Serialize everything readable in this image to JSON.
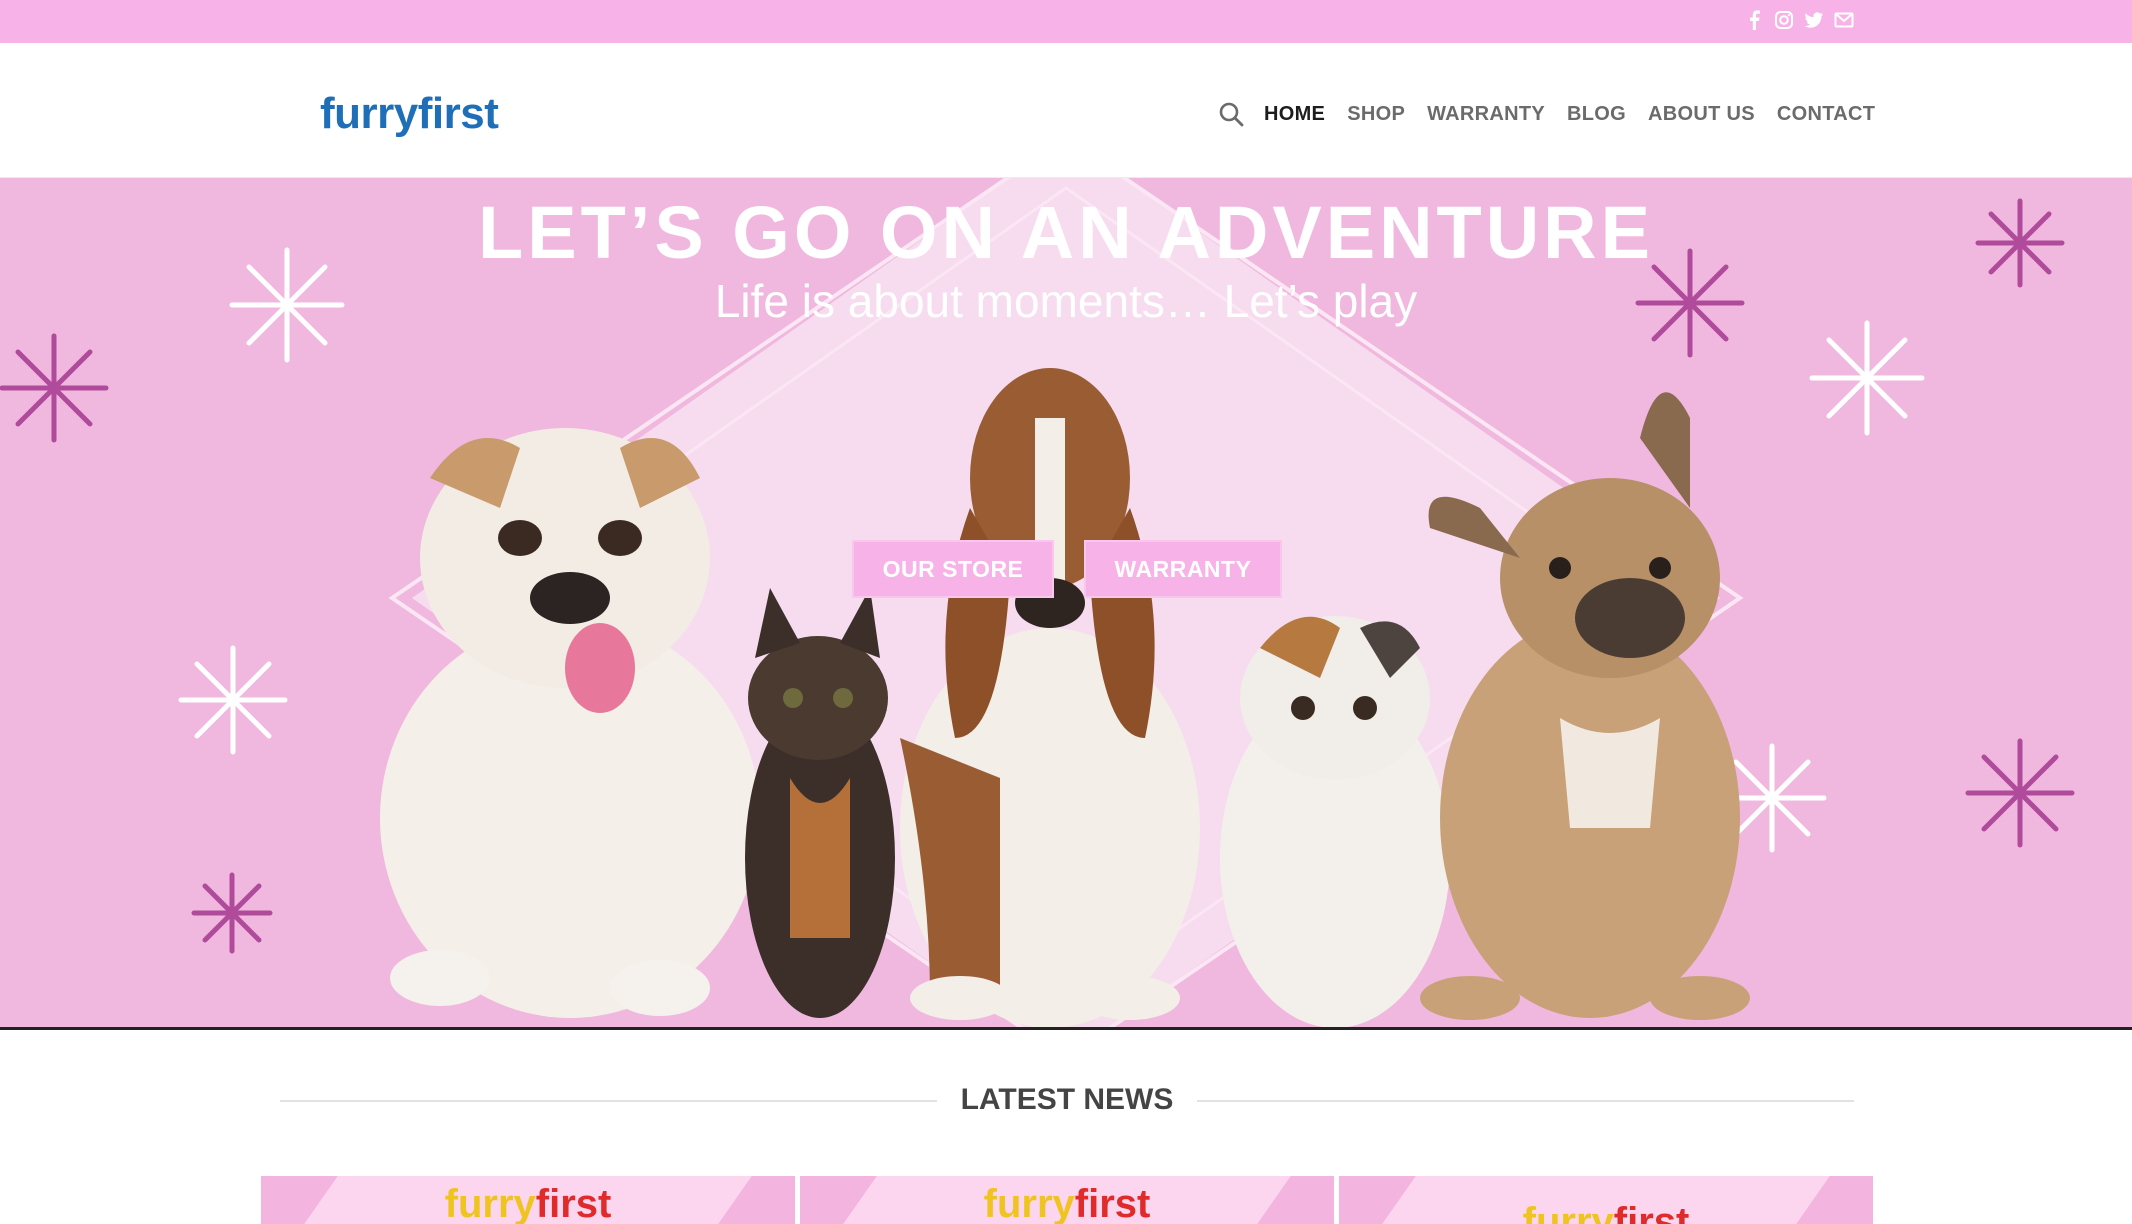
{
  "topbar": {
    "color": "#f7b3e8",
    "social_icons": [
      "facebook-icon",
      "instagram-icon",
      "twitter-icon",
      "email-icon"
    ]
  },
  "header": {
    "logo": "furryfirst",
    "nav": {
      "items": [
        "HOME",
        "SHOP",
        "WARRANTY",
        "BLOG",
        "ABOUT US",
        "CONTACT"
      ],
      "active": "HOME"
    }
  },
  "hero": {
    "title": "LET’S GO ON AN ADVENTURE",
    "subtitle": "Life is about moments… Let’s play",
    "buttons": {
      "store": "OUR STORE",
      "warranty": "WARRANTY"
    },
    "background_color": "#f0b8df",
    "accent_color": "#f7b3e8"
  },
  "news": {
    "heading": "LATEST NEWS",
    "cards": [
      {
        "brand_a": "furry",
        "brand_b": "first"
      },
      {
        "brand_a": "furry",
        "brand_b": "first"
      },
      {
        "brand_a": "furry",
        "brand_b": "first"
      }
    ]
  }
}
